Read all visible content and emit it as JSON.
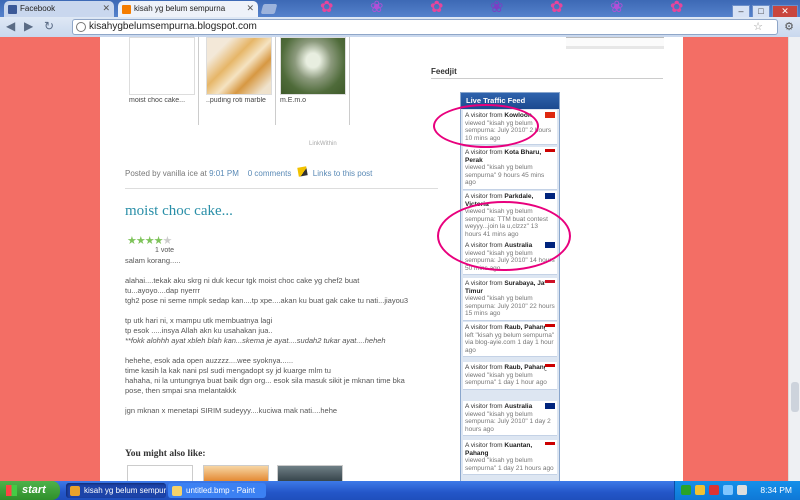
{
  "browser": {
    "tabs": [
      {
        "title": "Facebook",
        "active": false
      },
      {
        "title": "kisah yg belum sempurna",
        "active": true
      }
    ],
    "url": "kisahygbelumsempurna.blogspot.com"
  },
  "post": {
    "related_thumbs": [
      {
        "caption": "moist choc cake..."
      },
      {
        "caption": "..puding roti marble"
      },
      {
        "caption": "m.E.m.o"
      }
    ],
    "linkwithin": "LinkWithin",
    "meta": {
      "posted_by": "Posted by vanilla ice at",
      "time": "9:01 PM",
      "comments": "0 comments",
      "links": "Links to this post"
    },
    "title": "moist choc cake...",
    "rating": {
      "filled": 4,
      "total": 5,
      "votes": "1 vote"
    },
    "body": [
      "salam korang.....",
      "",
      "alahai....tekak aku skrg ni duk kecur tgk moist choc cake yg chef2 buat",
      "tu...ayoyo....dap nyerrr",
      "tgh2 pose ni seme nmpk sedap kan....tp xpe....akan ku buat gak cake tu nati...jiayou3",
      "",
      "tp utk hari ni, x mampu utk membuatnya lagi",
      "tp esok .....insya Allah akn ku usahakan jua..",
      "**fokk alohhh ayat xbleh blah kan...skema je ayat....sudah2 tukar ayat....heheh",
      "",
      "hehehe, esok ada open auzzzz....wee syoknya......",
      "time kasih la kak nani psl sudi mengadopt sy jd kuarge mlm tu",
      "hahaha, ni la untungnya buat baik dgn org... esok sila masuk sikit je mknan time bka",
      "pose, then smpai sna melantakkk",
      "",
      "jgn mknan x menetapi SIRIM sudeyyy....kuciwa mak nati....hehe"
    ],
    "might_also_like": "You might also like:"
  },
  "sidebar": {
    "feedjit": "Feedjit",
    "live_feed": {
      "title": "Live Traffic Feed",
      "items": [
        {
          "prefix": "A visitor from",
          "place": "Kowloon",
          "flag": "hk",
          "text": "viewed \"kisah yg belum sempurna: July 2010\" 2 hours 10 mins ago"
        },
        {
          "prefix": "A visitor from",
          "place": "Kota Bharu, Perak",
          "flag": "my",
          "text": "viewed \"kisah yg belum sempurna\" 9 hours 45 mins ago"
        },
        {
          "prefix": "A visitor from",
          "place": "Parkdale, Victoria",
          "flag": "au",
          "text": "viewed \"kisah yg belum sempurna: TTM buat contest weyyy...join la u,clzzz\" 13 hours 41 mins ago"
        },
        {
          "prefix": "A visitor from",
          "place": "Australia",
          "flag": "au",
          "text": "viewed \"kisah yg belum sempurna: July 2010\" 14 hours 50 mins ago"
        },
        {
          "prefix": "A visitor from",
          "place": "Surabaya, Jawa Timur",
          "flag": "id",
          "text": "viewed \"kisah yg belum sempurna: July 2010\" 22 hours 15 mins ago"
        },
        {
          "prefix": "A visitor from",
          "place": "Raub, Pahang",
          "flag": "my",
          "text": "left \"kisah yg belum sempurna\" via blog-ayie.com 1 day 1 hour ago"
        },
        {
          "prefix": "A visitor from",
          "place": "Raub, Pahang",
          "flag": "my",
          "text": "viewed \"kisah yg belum sempurna\" 1 day 1 hour ago"
        },
        {
          "prefix": "A visitor from",
          "place": "Australia",
          "flag": "au",
          "text": "viewed \"kisah yg belum sempurna: July 2010\" 1 day 2 hours ago"
        },
        {
          "prefix": "A visitor from",
          "place": "Kuantan, Pahang",
          "flag": "my",
          "text": "viewed \"kisah yg belum sempurna\" 1 day 21 hours ago"
        }
      ]
    }
  },
  "taskbar": {
    "start": "start",
    "items": [
      {
        "label": "kisah yg belum sempurna..."
      },
      {
        "label": "untitled.bmp - Paint"
      }
    ],
    "clock": "8:34 PM"
  },
  "colors": {
    "background": "#f36e65",
    "title": "#2a8fa8",
    "highlight_circle": "#e8007d",
    "feed_header": "#1c4a8f"
  }
}
